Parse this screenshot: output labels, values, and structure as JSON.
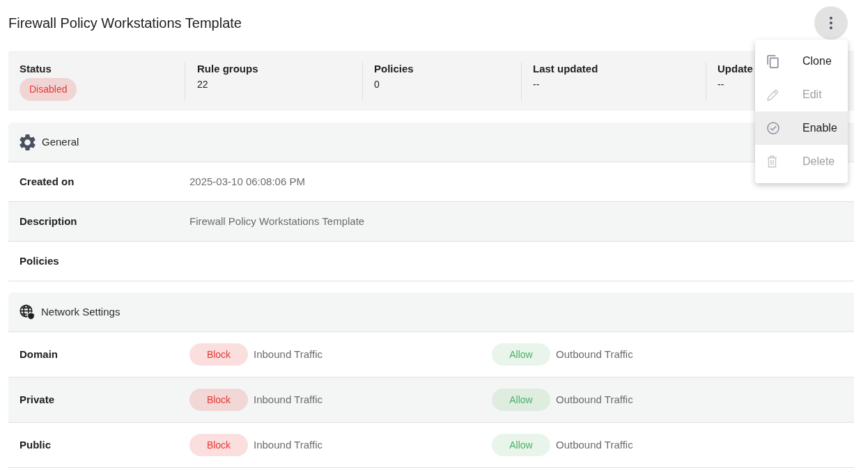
{
  "page": {
    "title": "Firewall Policy Workstations Template"
  },
  "summary": [
    {
      "label": "Status",
      "value": "Disabled",
      "kind": "badge"
    },
    {
      "label": "Rule groups",
      "value": "22",
      "kind": "text"
    },
    {
      "label": "Policies",
      "value": "0",
      "kind": "text"
    },
    {
      "label": "Last updated",
      "value": "--",
      "kind": "text"
    },
    {
      "label": "Update",
      "value": "--",
      "kind": "text"
    }
  ],
  "sections": [
    {
      "title": "General",
      "kind": "general",
      "rows": [
        {
          "label": "Created on",
          "value": "2025-03-10 06:08:06 PM"
        },
        {
          "label": "Description",
          "value": "Firewall Policy Workstations Template"
        },
        {
          "label": "Policies"
        }
      ]
    },
    {
      "title": "Network Settings",
      "kind": "network",
      "rows": [
        {
          "label": "Domain",
          "inbound": {
            "action": "Block",
            "kind": "block",
            "text": "Inbound Traffic"
          },
          "outbound": {
            "action": "Allow",
            "kind": "allow",
            "text": "Outbound Traffic"
          }
        },
        {
          "label": "Private",
          "inbound": {
            "action": "Block",
            "kind": "block",
            "text": "Inbound Traffic"
          },
          "outbound": {
            "action": "Allow",
            "kind": "allow",
            "text": "Outbound Traffic"
          }
        },
        {
          "label": "Public",
          "inbound": {
            "action": "Block",
            "kind": "block",
            "text": "Inbound Traffic"
          },
          "outbound": {
            "action": "Allow",
            "kind": "allow",
            "text": "Outbound Traffic"
          }
        }
      ]
    }
  ],
  "menu": [
    {
      "label": "Clone",
      "kind": "clone",
      "disabled": false,
      "highlighted": false
    },
    {
      "label": "Edit",
      "kind": "edit",
      "disabled": true,
      "highlighted": false
    },
    {
      "label": "Enable",
      "kind": "enable",
      "disabled": false,
      "highlighted": true
    },
    {
      "label": "Delete",
      "kind": "delete",
      "disabled": true,
      "highlighted": false
    }
  ]
}
